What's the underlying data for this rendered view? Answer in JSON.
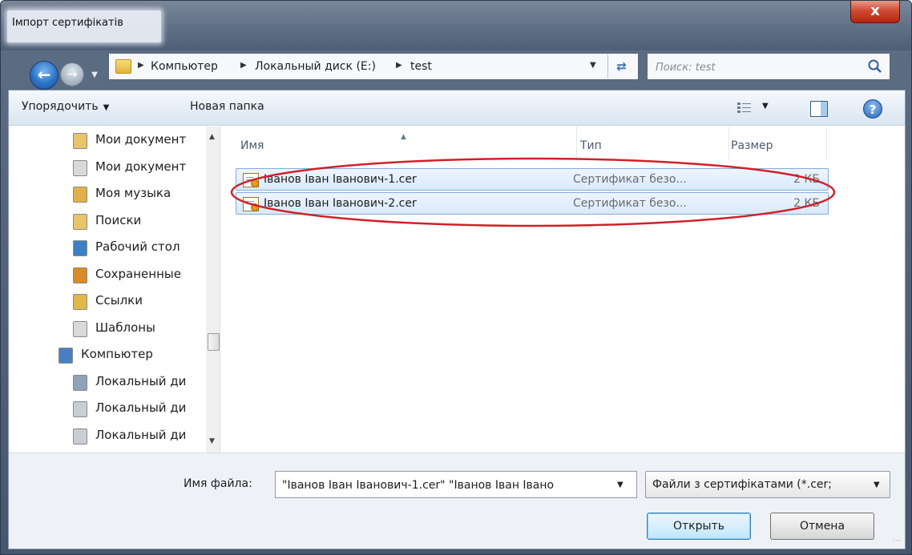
{
  "window": {
    "title": "Імпорт сертифікатів",
    "close_label": "x"
  },
  "address": {
    "crumbs": [
      "Компьютер",
      "Локальный диск (E:)",
      "test"
    ],
    "search_placeholder": "Поиск: test"
  },
  "toolbar": {
    "organize_label": "Упорядочить",
    "new_folder_label": "Новая папка"
  },
  "nav": {
    "items": [
      {
        "label": "Мои документ",
        "icon": "documents-icon"
      },
      {
        "label": "Мои документ",
        "icon": "documents-shortcut-icon"
      },
      {
        "label": "Моя музыка",
        "icon": "music-icon"
      },
      {
        "label": "Поиски",
        "icon": "searches-icon"
      },
      {
        "label": "Рабочий стол",
        "icon": "desktop-icon"
      },
      {
        "label": "Сохраненные",
        "icon": "saved-games-icon"
      },
      {
        "label": "Ссылки",
        "icon": "links-icon"
      },
      {
        "label": "Шаблоны",
        "icon": "templates-icon"
      },
      {
        "label": "Компьютер",
        "icon": "computer-icon"
      },
      {
        "label": "Локальный ди",
        "icon": "system-drive-icon"
      },
      {
        "label": "Локальный ди",
        "icon": "drive-icon"
      },
      {
        "label": "Локальный ди",
        "icon": "drive-icon"
      }
    ]
  },
  "files": {
    "columns": {
      "name": "Имя",
      "type": "Тип",
      "size": "Размер"
    },
    "rows": [
      {
        "name": "Іванов Іван Іванович-1.cer",
        "type": "Сертификат безо...",
        "size": "2 КБ"
      },
      {
        "name": "Іванов Іван Іванович-2.cer",
        "type": "Сертификат безо...",
        "size": "2 КБ"
      }
    ]
  },
  "bottom": {
    "filename_label": "Имя файла:",
    "filename_value": "\"Іванов Іван Іванович-1.cer\" \"Іванов Іван Івано",
    "filetype_value": "Файли з сертифікатами (*.cer;",
    "open_label": "Открыть",
    "cancel_label": "Отмена"
  },
  "colors": {
    "highlight_ellipse": "#d0202a",
    "selection": "#d8e9fb"
  }
}
